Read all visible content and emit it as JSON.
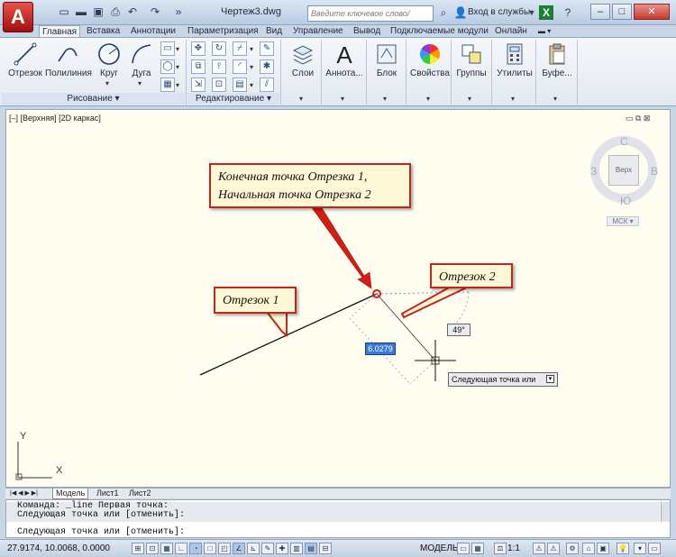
{
  "titlebar": {
    "app_letter": "A",
    "doc_title": "Чертеж3.dwg",
    "search_placeholder": "Введите ключевое слово/фразу",
    "signin_label": "Вход в службы"
  },
  "tabs": [
    "Главная",
    "Вставка",
    "Аннотации",
    "Параметризация",
    "Вид",
    "Управление",
    "Вывод",
    "Подключаемые модули",
    "Онлайн"
  ],
  "ribbon": {
    "draw_tools": [
      "Отрезок",
      "Полилиния",
      "Круг",
      "Дуга"
    ],
    "draw_panel_label": "Рисование",
    "modify_panel_label": "Редактирование",
    "big_tools": [
      "Слои",
      "Аннота...",
      "Блок",
      "Свойства",
      "Группы",
      "Утилиты",
      "Буфе..."
    ]
  },
  "viewport": {
    "label": "[–] [Верхняя] [2D каркас]",
    "viewcube_top": "Верх",
    "compass_n": "С",
    "compass_s": "Ю",
    "compass_w": "З",
    "compass_e": "В",
    "ucs_label": "МСК"
  },
  "callouts": {
    "end_point_line1": "Конечная точка Отрезка 1,",
    "end_point_line2": "Начальная точка Отрезка 2",
    "segment1": "Отрезок 1",
    "segment2": "Отрезок 2"
  },
  "dynamic_input": {
    "length_value": "6.0279",
    "angle_value": "49°",
    "prompt": "Следующая точка или"
  },
  "ucs_axes": {
    "x": "X",
    "y": "Y"
  },
  "layout_tabs": [
    "Модель",
    "Лист1",
    "Лист2"
  ],
  "command_line": {
    "history_1": "Команда: _line Первая точка:",
    "history_2": "Следующая точка или [отменить]:",
    "current": "Следующая точка или [отменить]:"
  },
  "status_bar": {
    "coordinates": "27.9174, 10.0068, 0.0000",
    "space": "МОДЕЛЬ",
    "scale": "1:1"
  },
  "colors": {
    "canvas_bg": "#fffdf0",
    "callout_border": "#c0281f",
    "arrow": "#d41e14",
    "input_highlight": "#3b78d8"
  }
}
